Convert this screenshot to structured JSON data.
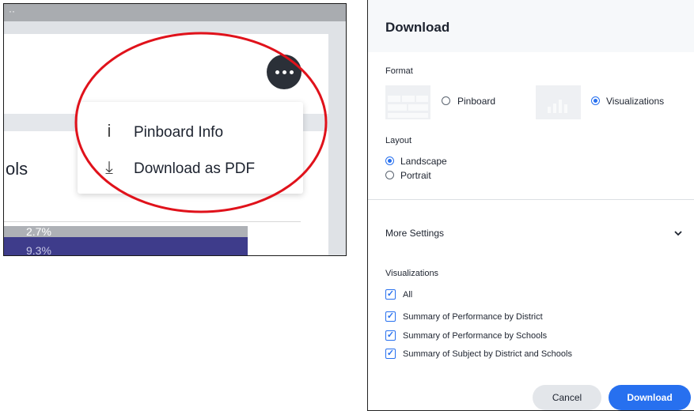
{
  "left_panel": {
    "title_fragment": "ols",
    "bar_values": [
      "2.7%",
      "9.3%"
    ],
    "more_button_icon": "more-horizontal-icon",
    "menu": [
      {
        "icon": "info-icon",
        "glyph": "i",
        "label": "Pinboard Info"
      },
      {
        "icon": "download-icon",
        "glyph": "⤓",
        "label": "Download as PDF"
      }
    ],
    "highlight_color": "#e0121b"
  },
  "dialog": {
    "title": "Download",
    "format": {
      "label": "Format",
      "options": [
        {
          "label": "Pinboard",
          "selected": false
        },
        {
          "label": "Visualizations",
          "selected": true
        }
      ]
    },
    "layout": {
      "label": "Layout",
      "options": [
        {
          "label": "Landscape",
          "selected": true
        },
        {
          "label": "Portrait",
          "selected": false
        }
      ]
    },
    "more_settings": {
      "label": "More Settings",
      "icon": "chevron-down-icon"
    },
    "visualizations": {
      "label": "Visualizations",
      "items": [
        {
          "label": "All",
          "checked": true
        },
        {
          "label": "Summary of Performance by District",
          "checked": true
        },
        {
          "label": "Summary of Performance by Schools",
          "checked": true
        },
        {
          "label": "Summary of Subject by District and Schools",
          "checked": true
        }
      ]
    },
    "buttons": {
      "cancel": "Cancel",
      "download": "Download"
    },
    "accent_color": "#2770ef"
  }
}
